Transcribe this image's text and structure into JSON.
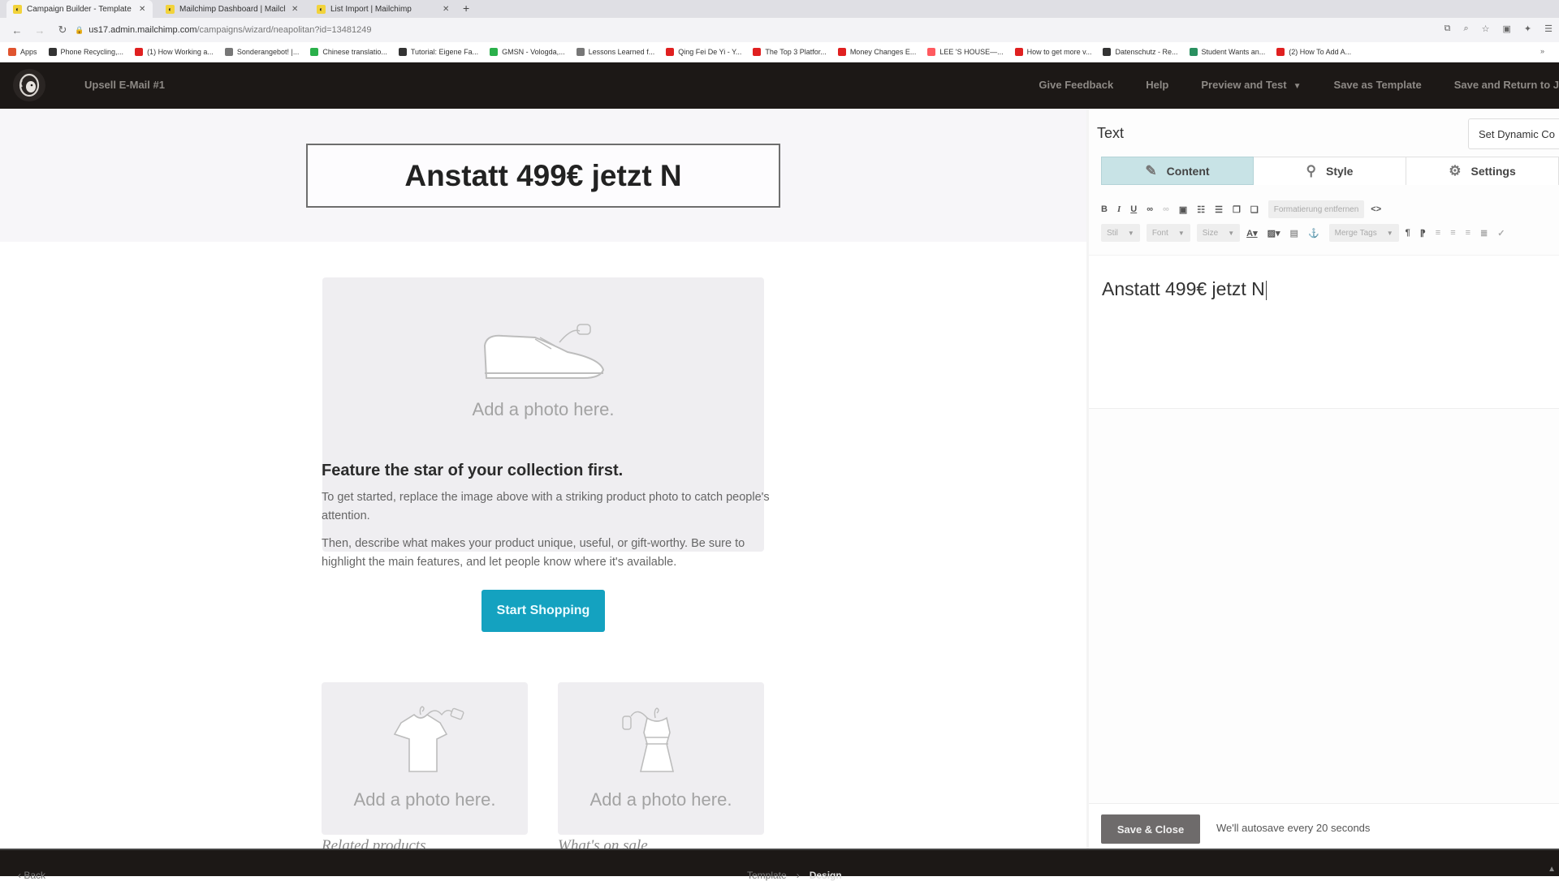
{
  "browser": {
    "tabs": [
      {
        "title": "Campaign Builder - Template",
        "active": true
      },
      {
        "title": "Mailchimp Dashboard | Mailch",
        "active": false
      },
      {
        "title": "List Import | Mailchimp",
        "active": false
      }
    ],
    "new_tab": "+",
    "url_domain": "us17.admin.mailchimp.com",
    "url_path": "/campaigns/wizard/neapolitan?id=13481249",
    "bookmarks": [
      {
        "label": "Apps",
        "color": "#e0542f"
      },
      {
        "label": "Phone Recycling,...",
        "color": "#333333"
      },
      {
        "label": "(1) How Working a...",
        "color": "#e02020"
      },
      {
        "label": "Sonderangebot! |...",
        "color": "#777777"
      },
      {
        "label": "Chinese translatio...",
        "color": "#2ab04a"
      },
      {
        "label": "Tutorial: Eigene Fa...",
        "color": "#333333"
      },
      {
        "label": "GMSN - Vologda,...",
        "color": "#2ab04a"
      },
      {
        "label": "Lessons Learned f...",
        "color": "#777777"
      },
      {
        "label": "Qing Fei De Yi - Y...",
        "color": "#e02020"
      },
      {
        "label": "The Top 3 Platfor...",
        "color": "#e02020"
      },
      {
        "label": "Money Changes E...",
        "color": "#e02020"
      },
      {
        "label": "LEE 'S HOUSE—...",
        "color": "#ff5a5f"
      },
      {
        "label": "How to get more v...",
        "color": "#e02020"
      },
      {
        "label": "Datenschutz - Re...",
        "color": "#333333"
      },
      {
        "label": "Student Wants an...",
        "color": "#2a9060"
      },
      {
        "label": "(2) How To Add A...",
        "color": "#e02020"
      }
    ],
    "bookmarks_more": "»"
  },
  "header": {
    "campaign_name": "Upsell E-Mail #1",
    "nav": {
      "feedback": "Give Feedback",
      "help": "Help",
      "preview": "Preview and Test",
      "save_template": "Save as Template",
      "save_return": "Save and Return to J"
    }
  },
  "canvas": {
    "headline": "Anstatt 499€ jetzt N",
    "photo_placeholder": "Add a photo here.",
    "feature_title": "Feature the star of your collection first.",
    "paragraph1": "To get started, replace the image above with a striking product photo to catch people's attention.",
    "paragraph2": "Then, describe what makes your product unique, useful, or gift-worthy. Be sure to highlight the main features, and let people know where it's available.",
    "cta_label": "Start Shopping",
    "cta_color": "#14a2c0",
    "small_photos": [
      {
        "caption": "Add a photo here.",
        "label": "Related products"
      },
      {
        "caption": "Add a photo here.",
        "label": "What's on sale"
      }
    ]
  },
  "panel": {
    "title": "Text",
    "dynamic_content": "Set Dynamic Co",
    "tabs": [
      {
        "label": "Content",
        "icon": "pencil-list-icon",
        "active": true
      },
      {
        "label": "Style",
        "icon": "brush-icon",
        "active": false
      },
      {
        "label": "Settings",
        "icon": "gear-icon",
        "active": false
      }
    ],
    "toolbar_row1": {
      "bold": "B",
      "italic": "I",
      "underline": "U",
      "remove_format": "Formatierung entfernen",
      "source": "<>"
    },
    "toolbar_row2": {
      "style": "Stil",
      "font": "Font",
      "size": "Size",
      "merge_tags": "Merge Tags"
    },
    "editor_text": "Anstatt 499€ jetzt N",
    "save_close": "Save & Close",
    "autosave": "We'll autosave every 20 seconds"
  },
  "footer": {
    "back": "Back",
    "steps": [
      "Template",
      "Design"
    ],
    "separator": "›"
  }
}
